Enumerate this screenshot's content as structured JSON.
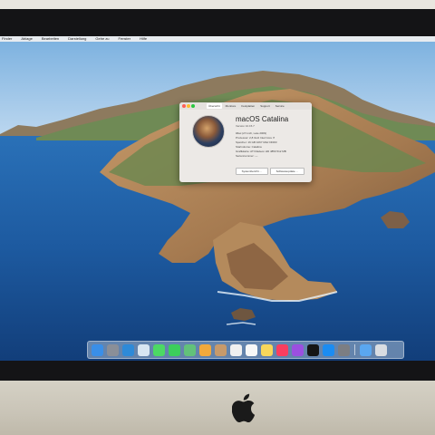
{
  "menubar": {
    "items": [
      "Finder",
      "Ablage",
      "Bearbeiten",
      "Darstellung",
      "Gehe zu",
      "Fenster",
      "Hilfe"
    ]
  },
  "about_window": {
    "tabs": [
      "Übersicht",
      "Monitore",
      "Festplatten",
      "Support",
      "Service"
    ],
    "active_tab": "Übersicht",
    "os_name": "macOS Catalina",
    "version": "Version 10.15.7",
    "specs": [
      "iMac (27-inch, Late 2009)",
      "Prozessor: 2,8 GHz Intel Core i7",
      "Speicher: 16 GB 1067 MHz DDR3",
      "Startvolume: Catalina",
      "Grafikkarte: ATI Radeon HD 4850 512 MB",
      "Seriennummer: —"
    ],
    "buttons": [
      "Systembericht …",
      "Softwareupdate …"
    ]
  },
  "dock": {
    "icons": [
      "finder-icon",
      "launchpad-icon",
      "safari-icon",
      "preview-icon",
      "messages-icon",
      "facetime-icon",
      "maps-icon",
      "photos-icon",
      "contacts-icon",
      "calendar-icon",
      "reminders-icon",
      "notes-icon",
      "music-icon",
      "podcasts-icon",
      "tv-icon",
      "app-store-icon",
      "system-preferences-icon",
      "downloads-icon",
      "trash-icon"
    ],
    "colors": [
      "#3a8fe8",
      "#8a8f98",
      "#2e8ad8",
      "#d8e6f2",
      "#4cd964",
      "#3ccf5b",
      "#62c27a",
      "#f2a93b",
      "#c79a6b",
      "#f0f0f0",
      "#f7f7f7",
      "#f7d65a",
      "#fa3e5f",
      "#9b4fe0",
      "#151515",
      "#1b8cf2",
      "#7c7e83",
      "#5aa7f0",
      "#d9dde2"
    ]
  },
  "colors": {
    "sky_top": "#7fb2e0",
    "sea": "#1f5da3",
    "rock": "#b88a5e"
  }
}
